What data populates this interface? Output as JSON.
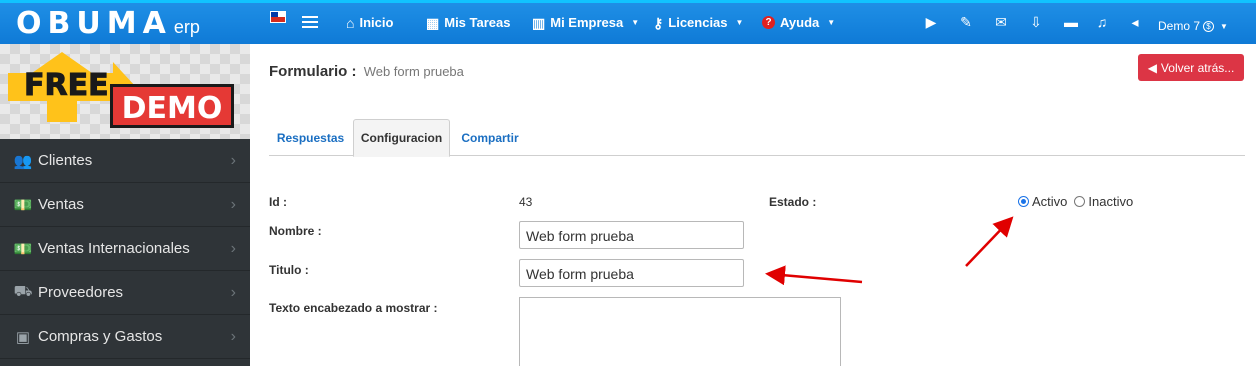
{
  "brand": {
    "logo_text": "OBUMA",
    "logo_suffix": "erp"
  },
  "topnav": {
    "items": [
      {
        "icon": "home-icon",
        "label": "Inicio"
      },
      {
        "icon": "calendar-icon",
        "label": "Mis Tareas"
      },
      {
        "icon": "building-icon",
        "label": "Mi Empresa"
      },
      {
        "icon": "key-icon",
        "label": "Licencias"
      },
      {
        "icon": "help-icon",
        "label": "Ayuda"
      }
    ],
    "user_label": "Demo 7"
  },
  "sidebar": {
    "promo": {
      "line1": "FREE",
      "line2": "DEMO"
    },
    "items": [
      {
        "icon": "users-icon",
        "label": "Clientes"
      },
      {
        "icon": "money-icon",
        "label": "Ventas"
      },
      {
        "icon": "money-icon",
        "label": "Ventas Internacionales"
      },
      {
        "icon": "truck-icon",
        "label": "Proveedores"
      },
      {
        "icon": "cash-icon",
        "label": "Compras y Gastos"
      }
    ]
  },
  "page": {
    "title": "Formulario :",
    "subtitle": "Web form prueba",
    "back_label": "Volver atrás..."
  },
  "tabs": [
    {
      "label": "Respuestas",
      "active": false
    },
    {
      "label": "Configuracion",
      "active": true
    },
    {
      "label": "Compartir",
      "active": false
    }
  ],
  "form": {
    "id_label": "Id :",
    "id_value": "43",
    "nombre_label": "Nombre :",
    "nombre_value": "Web form prueba",
    "titulo_label": "Titulo :",
    "titulo_value": "Web form prueba",
    "header_text_label": "Texto encabezado a mostrar :",
    "estado_label": "Estado :",
    "estado_options": [
      "Activo",
      "Inactivo"
    ],
    "estado_selected": "Activo"
  },
  "colors": {
    "topbar": "#1482db",
    "sidebar": "#2f3438",
    "back_button": "#dc3545",
    "link": "#1b6fc2",
    "annotation_arrow": "#e00000"
  }
}
